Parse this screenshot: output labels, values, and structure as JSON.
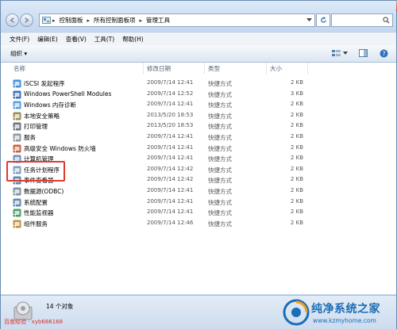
{
  "address": {
    "crumbs": [
      "控制面板",
      "所有控制面板项",
      "管理工具"
    ]
  },
  "menu": [
    "文件(F)",
    "编辑(E)",
    "查看(V)",
    "工具(T)",
    "帮助(H)"
  ],
  "toolbar": {
    "organize_label": "组织 ▾"
  },
  "columns": {
    "name": "名称",
    "date": "修改日期",
    "type": "类型",
    "size": "大小"
  },
  "files": [
    {
      "name": "iSCSI 发起程序",
      "date": "2009/7/14 12:41",
      "type": "快捷方式",
      "size": "2 KB",
      "icon": "iscsi-icon"
    },
    {
      "name": "Windows PowerShell Modules",
      "date": "2009/7/14 12:52",
      "type": "快捷方式",
      "size": "3 KB",
      "icon": "powershell-icon"
    },
    {
      "name": "Windows 内存诊断",
      "date": "2009/7/14 12:41",
      "type": "快捷方式",
      "size": "2 KB",
      "icon": "memory-diagnostic-icon"
    },
    {
      "name": "本地安全策略",
      "date": "2013/5/20 18:53",
      "type": "快捷方式",
      "size": "2 KB",
      "icon": "security-policy-icon"
    },
    {
      "name": "打印管理",
      "date": "2013/5/20 18:53",
      "type": "快捷方式",
      "size": "2 KB",
      "icon": "printer-icon"
    },
    {
      "name": "服务",
      "date": "2009/7/14 12:41",
      "type": "快捷方式",
      "size": "2 KB",
      "icon": "services-icon"
    },
    {
      "name": "高级安全 Windows 防火墙",
      "date": "2009/7/14 12:41",
      "type": "快捷方式",
      "size": "2 KB",
      "icon": "firewall-icon"
    },
    {
      "name": "计算机管理",
      "date": "2009/7/14 12:41",
      "type": "快捷方式",
      "size": "2 KB",
      "icon": "computer-management-icon"
    },
    {
      "name": "任务计划程序",
      "date": "2009/7/14 12:42",
      "type": "快捷方式",
      "size": "2 KB",
      "icon": "task-scheduler-icon"
    },
    {
      "name": "事件查看器",
      "date": "2009/7/14 12:42",
      "type": "快捷方式",
      "size": "2 KB",
      "icon": "event-viewer-icon"
    },
    {
      "name": "数据源(ODBC)",
      "date": "2009/7/14 12:41",
      "type": "快捷方式",
      "size": "2 KB",
      "icon": "odbc-icon"
    },
    {
      "name": "系统配置",
      "date": "2009/7/14 12:41",
      "type": "快捷方式",
      "size": "2 KB",
      "icon": "system-config-icon"
    },
    {
      "name": "性能监视器",
      "date": "2009/7/14 12:41",
      "type": "快捷方式",
      "size": "2 KB",
      "icon": "performance-monitor-icon"
    },
    {
      "name": "组件服务",
      "date": "2009/7/14 12:46",
      "type": "快捷方式",
      "size": "2 KB",
      "icon": "component-services-icon"
    }
  ],
  "highlighted_index": 8,
  "status": {
    "count_text": "14 个对象"
  },
  "watermarks": {
    "left": "百度经验 · xyb666168",
    "right_title": "纯净系统之家",
    "right_url": "www.kzmyhome.com"
  },
  "colors": {
    "highlight": "#e03a2f",
    "brand": "#1b6db5"
  }
}
